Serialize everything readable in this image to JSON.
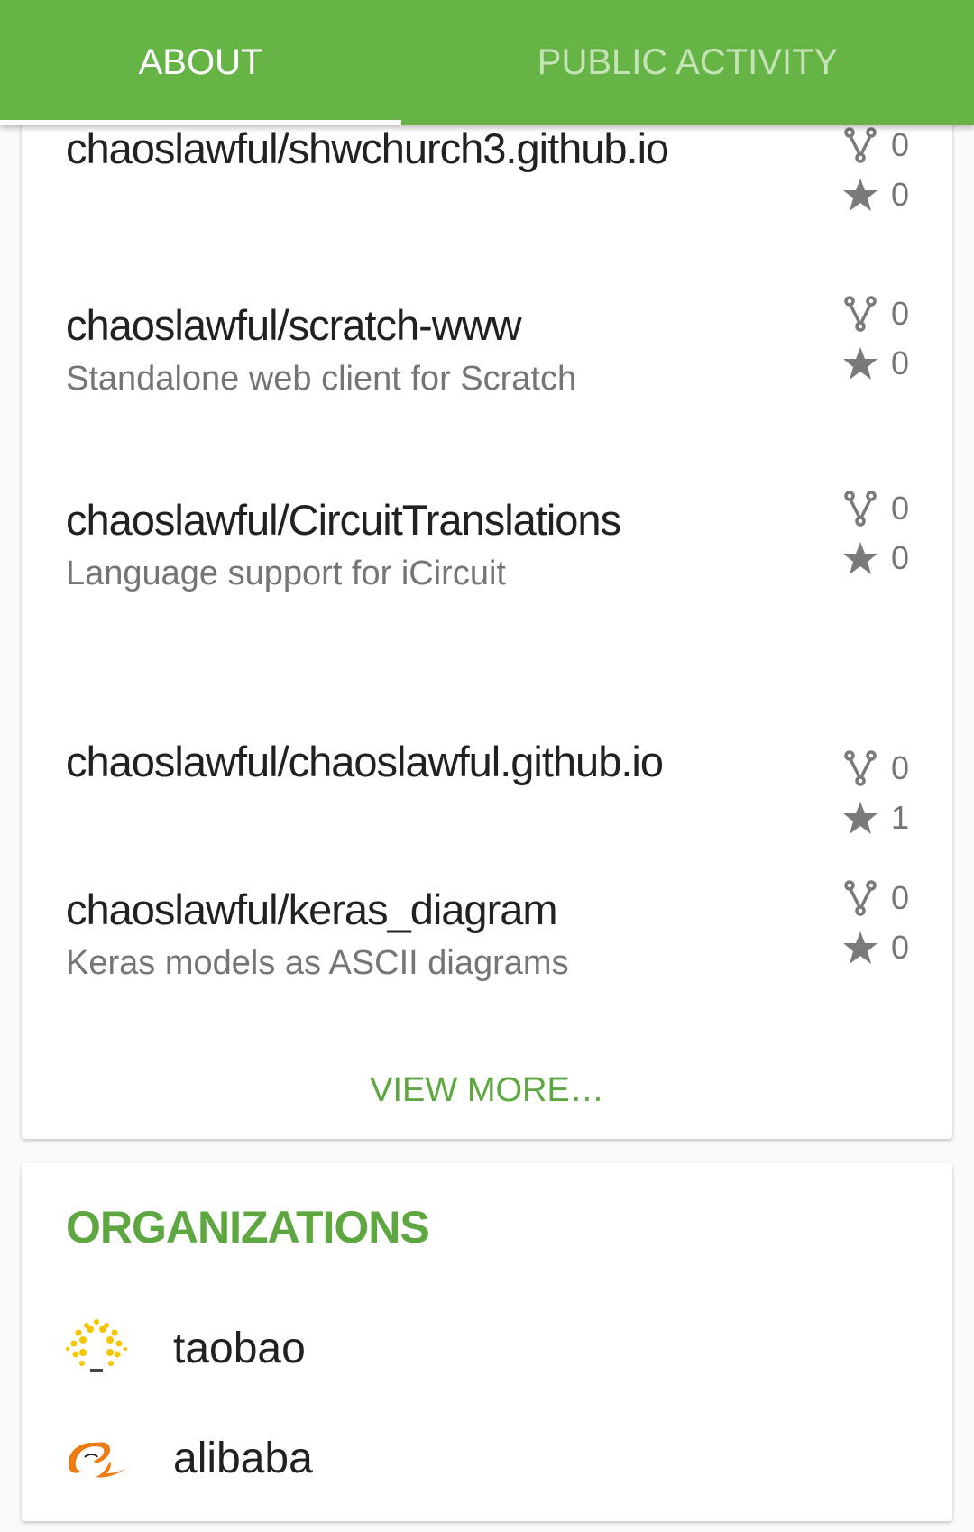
{
  "tabs": [
    {
      "label": "ABOUT",
      "active": true
    },
    {
      "label": "PUBLIC ACTIVITY",
      "active": false
    }
  ],
  "colors": {
    "primary": "#66b446",
    "accent": "#5ea63f",
    "icon": "#7a7a7a"
  },
  "repositories": [
    {
      "name": "chaoslawful/shwchurch3.github.io",
      "description": "",
      "forks": "0",
      "stars": "0"
    },
    {
      "name": "chaoslawful/scratch-www",
      "description": "Standalone web client for Scratch",
      "forks": "0",
      "stars": "0"
    },
    {
      "name": "chaoslawful/CircuitTranslations",
      "description": "Language support for iCircuit",
      "forks": "0",
      "stars": "0"
    },
    {
      "name": "chaoslawful/chaoslawful.github.io",
      "description": "",
      "forks": "0",
      "stars": "1"
    },
    {
      "name": "chaoslawful/keras_diagram",
      "description": "Keras models as ASCII diagrams",
      "forks": "0",
      "stars": "0"
    }
  ],
  "view_more": "VIEW MORE…",
  "organizations": {
    "title": "ORGANIZATIONS",
    "items": [
      {
        "name": "taobao",
        "icon": "taobao-logo"
      },
      {
        "name": "alibaba",
        "icon": "alibaba-logo"
      }
    ]
  },
  "icons": {
    "fork": "fork-icon",
    "star": "star-icon"
  }
}
